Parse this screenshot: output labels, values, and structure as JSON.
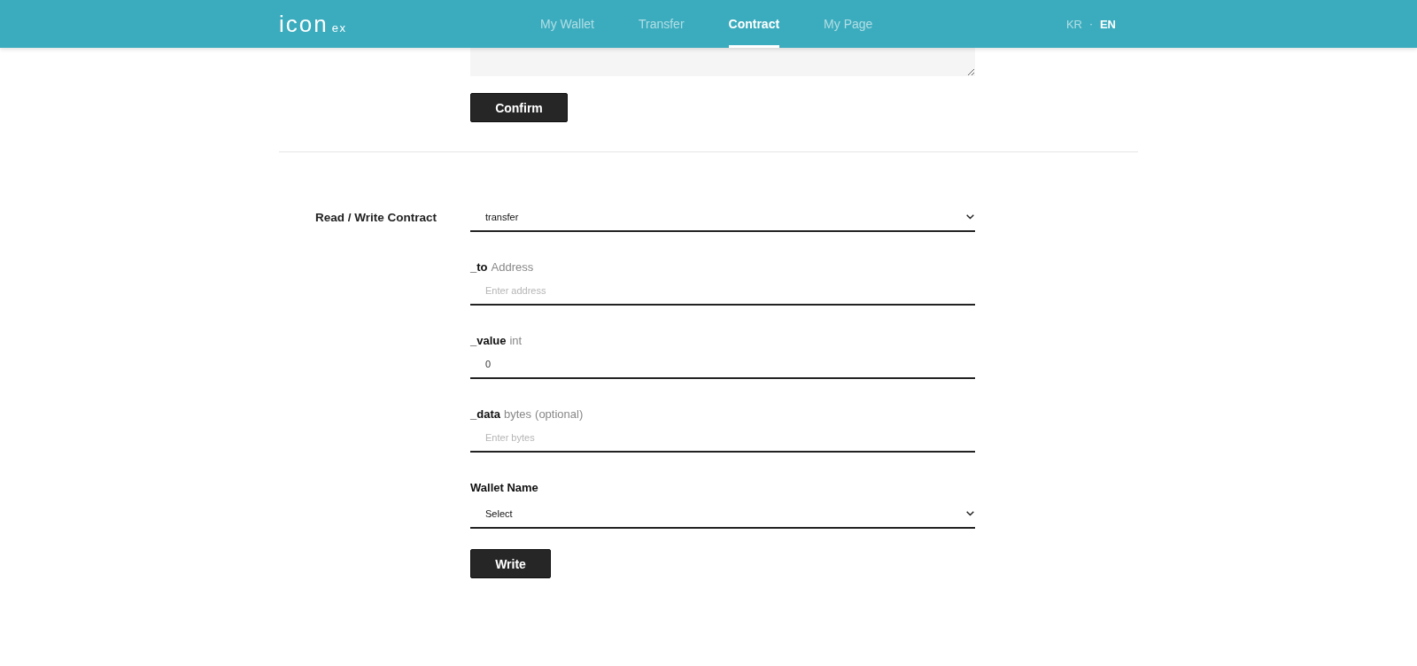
{
  "header": {
    "logo": {
      "main": "icon",
      "suffix": "ex"
    },
    "nav": [
      {
        "label": "My Wallet",
        "selected": false
      },
      {
        "label": "Transfer",
        "selected": false
      },
      {
        "label": "Contract",
        "selected": true
      },
      {
        "label": "My Page",
        "selected": false
      }
    ],
    "languages": [
      {
        "label": "KR",
        "selected": false
      },
      {
        "label": "EN",
        "selected": true
      }
    ],
    "language_separator": "·"
  },
  "confirm_button": "Confirm",
  "read_write": {
    "label": "Read / Write Contract",
    "method_select": {
      "value": "transfer"
    },
    "params": [
      {
        "name": "_to",
        "type": "Address",
        "placeholder": "Enter address"
      },
      {
        "name": "_value",
        "type": "int",
        "value": "0"
      },
      {
        "name": "_data",
        "type": "bytes",
        "note": "(optional)",
        "placeholder": "Enter bytes"
      }
    ],
    "wallet": {
      "label": "Wallet Name",
      "select": {
        "value": "Select"
      }
    },
    "write_button": "Write"
  }
}
